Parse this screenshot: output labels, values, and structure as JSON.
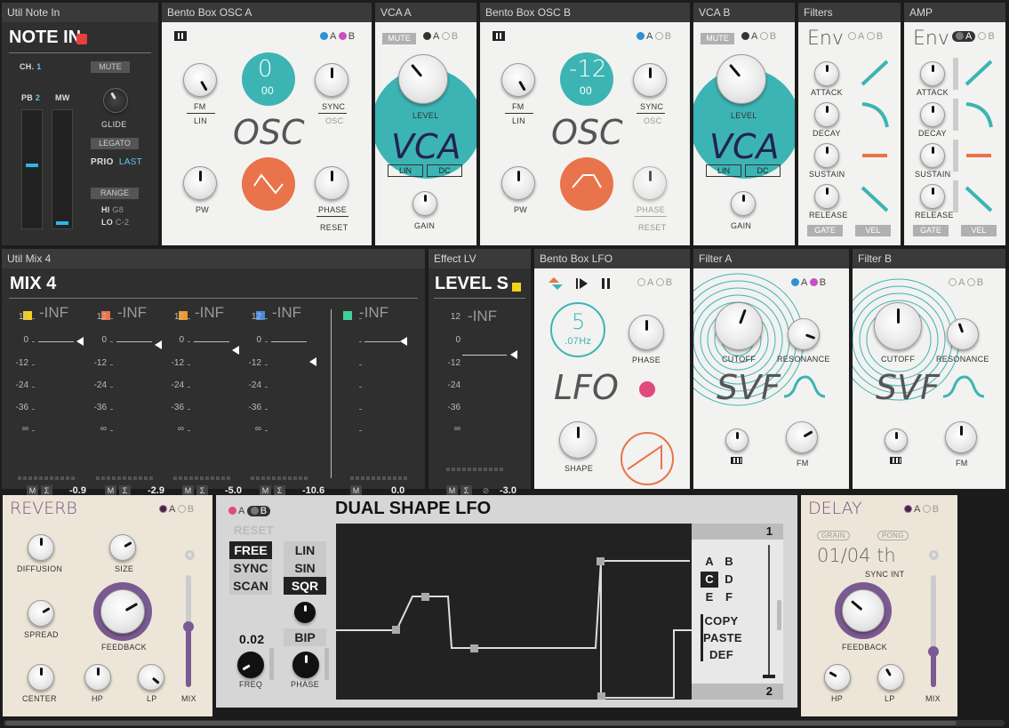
{
  "note_in": {
    "header": "Util Note In",
    "title": "NOTE IN",
    "ch_label": "CH.",
    "ch": "1",
    "mute": "MUTE",
    "pb_label": "PB",
    "pb": "2",
    "mw": "MW",
    "glide": "GLIDE",
    "legato": "LEGATO",
    "prio_label": "PRIO",
    "prio": "LAST",
    "range": "RANGE",
    "hi_label": "HI",
    "hi": "G8",
    "lo_label": "LO",
    "lo": "C-2"
  },
  "osc_a": {
    "header": "Bento Box OSC A",
    "a": "A",
    "b": "B",
    "fm": "FM",
    "lin": "LIN",
    "sync": "SYNC",
    "osc_small": "OSC",
    "big": "OSC",
    "value": "0",
    "value_sub": "00",
    "pw": "PW",
    "phase": "PHASE",
    "reset": "RESET"
  },
  "vca_a": {
    "header": "VCA A",
    "mute": "MUTE",
    "a": "A",
    "b": "B",
    "level": "LEVEL",
    "big": "VCA",
    "lin": "LIN",
    "dc": "DC",
    "gain": "GAIN"
  },
  "osc_b": {
    "header": "Bento Box OSC B",
    "a": "A",
    "b": "B",
    "fm": "FM",
    "lin": "LIN",
    "sync": "SYNC",
    "osc_small": "OSC",
    "big": "OSC",
    "value": "-12",
    "value_sub": "00",
    "pw": "PW",
    "phase": "PHASE",
    "reset": "RESET"
  },
  "vca_b": {
    "header": "VCA B",
    "mute": "MUTE",
    "a": "A",
    "b": "B",
    "level": "LEVEL",
    "big": "VCA",
    "lin": "LIN",
    "dc": "DC",
    "gain": "GAIN"
  },
  "filters": {
    "header": "Filters",
    "title": "Env",
    "a": "A",
    "b": "B",
    "attack": "ATTACK",
    "decay": "DECAY",
    "sustain": "SUSTAIN",
    "release": "RELEASE",
    "gate": "GATE",
    "vel": "VEL"
  },
  "amp": {
    "header": "AMP",
    "title": "Env",
    "a": "A",
    "b": "B",
    "attack": "ATTACK",
    "decay": "DECAY",
    "sustain": "SUSTAIN",
    "release": "RELEASE",
    "gate": "GATE",
    "vel": "VEL"
  },
  "mix": {
    "header": "Util Mix 4",
    "title": "MIX 4",
    "scale": [
      "12",
      "0",
      "-12",
      "-24",
      "-36",
      "∞"
    ],
    "channels": [
      {
        "color": "#f2d21b",
        "level": "-INF",
        "value": "-0.9"
      },
      {
        "color": "#e9734a",
        "level": "-INF",
        "value": "-2.9"
      },
      {
        "color": "#f0962a",
        "level": "-INF",
        "value": "-5.0"
      },
      {
        "color": "#4a8be0",
        "level": "-INF",
        "value": "-10.6"
      }
    ],
    "master": {
      "color": "#3fd09a",
      "level": "-INF",
      "value": "0.0"
    },
    "m": "M",
    "sigma": "Σ"
  },
  "level": {
    "header": "Effect LV",
    "title": "LEVEL S",
    "color": "#f2d21b",
    "level": "-INF",
    "value": "-3.0",
    "m": "M",
    "sigma": "Σ",
    "phi": "⊘"
  },
  "lfo": {
    "header": "Bento Box LFO",
    "a": "A",
    "b": "B",
    "rate": "5",
    "rate_sub": ".07Hz",
    "phase": "PHASE",
    "big": "LFO",
    "shape": "SHAPE"
  },
  "filter_a": {
    "header": "Filter A",
    "a": "A",
    "b": "B",
    "cutoff": "CUTOFF",
    "resonance": "RESONANCE",
    "big": "SVF",
    "fm": "FM"
  },
  "filter_b": {
    "header": "Filter B",
    "a": "A",
    "b": "B",
    "cutoff": "CUTOFF",
    "resonance": "RESONANCE",
    "big": "SVF",
    "fm": "FM"
  },
  "reverb": {
    "title": "REVERB",
    "a": "A",
    "b": "B",
    "diffusion": "DIFFUSION",
    "size": "SIZE",
    "spread": "SPREAD",
    "feedback": "FEEDBACK",
    "center": "CENTER",
    "hp": "HP",
    "lp": "LP",
    "mix": "MIX"
  },
  "dual": {
    "title": "DUAL SHAPE LFO",
    "a": "A",
    "b": "B",
    "reset": "RESET",
    "free": "FREE",
    "sync": "SYNC",
    "scan": "SCAN",
    "lin": "LIN",
    "sin": "SIN",
    "sqr": "SQR",
    "bip": "BIP",
    "freq_val": "0.02",
    "freq": "FREQ",
    "phase": "PHASE",
    "top": "1",
    "bottom": "2",
    "letters": [
      "A",
      "B",
      "C",
      "D",
      "E",
      "F"
    ],
    "copy": "COPY",
    "paste": "PASTE",
    "def": "DEF"
  },
  "delay": {
    "title": "DELAY",
    "a": "A",
    "b": "B",
    "grain": "GRAIN",
    "pong": "PONG",
    "time": "01/04 th",
    "sync": "SYNC INT",
    "feedback": "FEEDBACK",
    "hp": "HP",
    "lp": "LP",
    "mix": "MIX"
  }
}
